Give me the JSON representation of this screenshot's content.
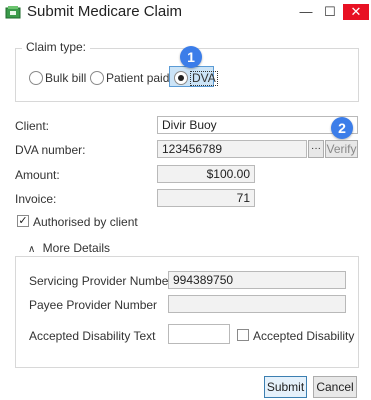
{
  "window": {
    "title": "Submit Medicare Claim",
    "min_glyph": "—",
    "max_glyph": "☐",
    "close_glyph": "✕"
  },
  "claim_type": {
    "legend": "Claim type:",
    "options": [
      "Bulk bill",
      "Patient paid",
      "DVA"
    ],
    "selected": "DVA"
  },
  "annotations": [
    "1",
    "2"
  ],
  "client": {
    "label": "Client:",
    "value": "Divir Buoy"
  },
  "dva_number": {
    "label": "DVA number:",
    "value": "123456789",
    "ellipsis": "···",
    "verify": "Verify"
  },
  "amount": {
    "label": "Amount:",
    "value": "$100.00"
  },
  "invoice": {
    "label": "Invoice:",
    "value": "71"
  },
  "authorised": {
    "label": "Authorised by client",
    "checked": true
  },
  "more_details": {
    "legend": "More Details",
    "servicing_label": "Servicing Provider Number",
    "servicing_value": "994389750",
    "payee_label": "Payee Provider Number",
    "payee_value": "",
    "disability_text_label": "Accepted Disability Text",
    "disability_text_value": "",
    "disability_check_label": "Accepted Disability"
  },
  "buttons": {
    "submit": "Submit",
    "cancel": "Cancel"
  },
  "colors": {
    "highlight": "#cce4f7",
    "badge": "#3b7de9",
    "close": "#e81123"
  }
}
